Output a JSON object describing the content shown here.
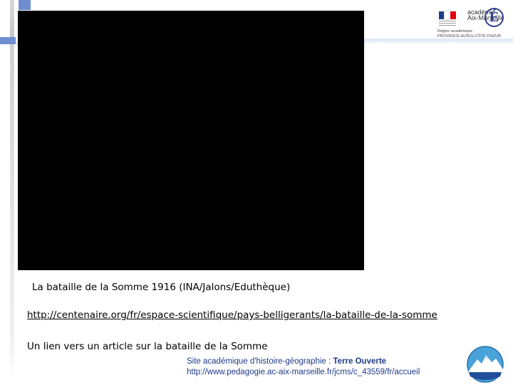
{
  "media": {
    "caption": "La bataille de la Somme 1916 (INA/Jalons/Eduthèque)"
  },
  "resource_link": {
    "url": "http://centenaire.org/fr/espace-scientifique/pays-belligerants/la-bataille-de-la-somme",
    "description": "Un lien vers un article sur la bataille de la Somme"
  },
  "logo": {
    "academie": [
      "académie",
      "Aix-Marseille"
    ],
    "region": [
      "Région académique",
      "PROVENCE-ALPES-CÔTE D'AZUR"
    ],
    "icon": "education-nationale-e-icon",
    "flag_colors": [
      "#1f3b8a",
      "#ffffff",
      "#e1000f"
    ]
  },
  "footer": {
    "site_prefix": "Site académique d'histoire-géographie : ",
    "site_name": "Terre Ouverte",
    "site_url": "http://www.pedagogie.ac-aix-marseille.fr/jcms/c_43559/fr/accueil",
    "logo_icon": "terre-ouverte-mountain-icon"
  },
  "colors": {
    "accent_blue": "#6f8fd0",
    "footer_text": "#1f3b8a"
  }
}
